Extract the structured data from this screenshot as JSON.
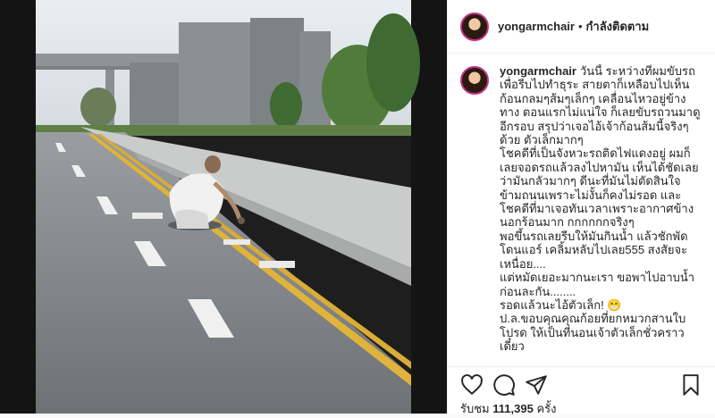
{
  "post": {
    "username": "yongarmchair",
    "follow_label": "กำลังติดตาม",
    "separator": "•"
  },
  "caption": {
    "username": "yongarmchair",
    "paragraphs": [
      "วันนี้ ระหว่างที่ผมขับรถ เพื่อรีบไปทำธุระ สายตาก็เหลือบไปเห็นก้อนกลมๆส้มๆเล็กๆ เคลื่อนไหวอยู่ข้างทาง ตอนแรกไม่แน่ใจ ก็เลยขับรถวนมาดูอีกรอบ สรุปว่าเจอไอ้เจ้าก้อนส้มนี้จริงๆด้วย ตัวเล็กมากๆ",
      "โชคดีที่เป็นจังหวะรถติดไฟแดงอยู่ ผมก็เลยจอดรถแล้วลงไปหามัน เห็นได้ชัดเลยว่ามันกลัวมากๆ ดีนะที่มันไม่ตัดสินใจข้ามถนนเพราะไม่งั้นก็คงไม่รอด และโชคดีที่มาเจอทันเวลาเพราะอากาศข้างนอกร้อนมาก กกกกกกจริงๆ",
      "พอขึ้นรถเลยรีบให้มันกินน้ำ แล้วชักพัดโดนแอร์ เคลิ้มหลับไปเลย555 สงสัยจะเหนื่อย....",
      "แต่หมัดเยอะมากนะเรา ขอพาไปอาบน้ำก่อนละกัน........",
      "รอดแล้วนะไอ้ตัวเล็ก! 😁",
      "ป.ล.ขอบคุณคุณก้อยที่ยกหมวกสานใบโปรด ให้เป็นที่นอนเจ้าตัวเล็กชั่วคราว เดี๋ยว"
    ]
  },
  "actions": {
    "like_icon": "heart-icon",
    "comment_icon": "comment-icon",
    "share_icon": "share-icon",
    "save_icon": "bookmark-icon"
  },
  "stats": {
    "views_label": "รับชม",
    "views_count": "111,395",
    "views_unit": "ครั้ง"
  }
}
